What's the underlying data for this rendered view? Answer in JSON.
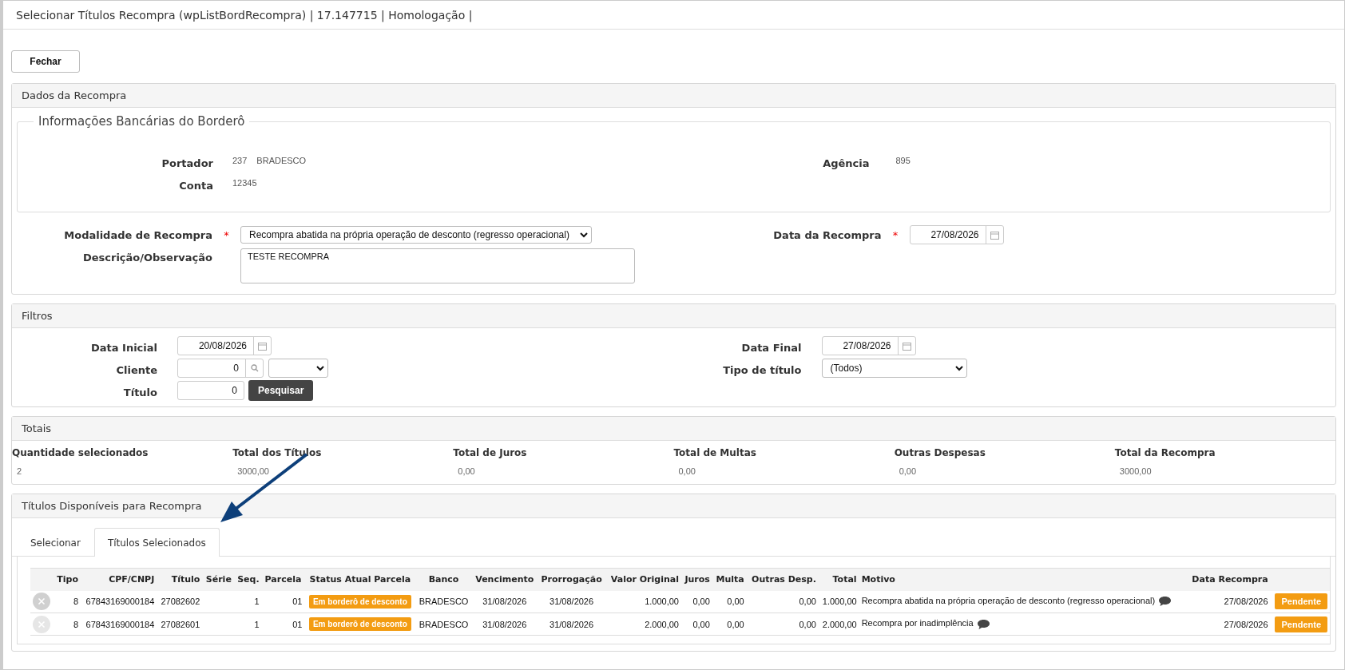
{
  "window": {
    "title": "Selecionar Títulos Recompra (wpListBordRecompra) | 17.147715 | Homologação |"
  },
  "close_button": "Fechar",
  "dados": {
    "title": "Dados da Recompra",
    "bank_info": {
      "legend": "Informações Bancárias do Borderô",
      "portador_label": "Portador",
      "portador_code": "237",
      "portador_name": "BRADESCO",
      "agencia_label": "Agência",
      "agencia": "895",
      "conta_label": "Conta",
      "conta": "12345"
    },
    "modalidade": {
      "label": "Modalidade de Recompra",
      "required_mark": "*",
      "value": "Recompra abatida na própria operação de desconto (regresso operacional)"
    },
    "data_recompra": {
      "label": "Data da Recompra",
      "required_mark": "*",
      "value": "27/08/2026"
    },
    "descricao": {
      "label": "Descrição/Observação",
      "value": "TESTE RECOMPRA"
    }
  },
  "filtros": {
    "title": "Filtros",
    "data_inicial": {
      "label": "Data Inicial",
      "value": "20/08/2026"
    },
    "data_final": {
      "label": "Data Final",
      "value": "27/08/2026"
    },
    "cliente": {
      "label": "Cliente",
      "value": "0"
    },
    "tipo_titulo": {
      "label": "Tipo de título",
      "value": "(Todos)"
    },
    "titulo": {
      "label": "Título",
      "value": "0"
    },
    "search_button": "Pesquisar"
  },
  "totais": {
    "title": "Totais",
    "items": [
      {
        "label": "Quantidade selecionados",
        "value": "2"
      },
      {
        "label": "Total dos Títulos",
        "value": "3000,00"
      },
      {
        "label": "Total de Juros",
        "value": "0,00"
      },
      {
        "label": "Total de Multas",
        "value": "0,00"
      },
      {
        "label": "Outras Despesas",
        "value": "0,00"
      },
      {
        "label": "Total da Recompra",
        "value": "3000,00"
      }
    ]
  },
  "titulos": {
    "title": "Títulos Disponíveis para Recompra",
    "tabs": [
      {
        "label": "Selecionar",
        "selected": false
      },
      {
        "label": "Títulos Selecionados",
        "selected": true
      }
    ],
    "table": {
      "columns": [
        "Tipo",
        "CPF/CNPJ",
        "Título",
        "Série",
        "Seq.",
        "Parcela",
        "Status Atual Parcela",
        "Banco",
        "Vencimento",
        "Prorrogação",
        "Valor Original",
        "Juros",
        "Multa",
        "Outras Desp.",
        "Total",
        "Motivo",
        "Data Recompra"
      ],
      "rows": [
        {
          "tipo": "8",
          "cpf_cnpj": "67843169000184",
          "titulo": "27082602",
          "serie": "",
          "seq": "1",
          "parcela": "01",
          "status": "Em borderô de desconto",
          "banco": "BRADESCO",
          "vencimento": "31/08/2026",
          "prorrogacao": "31/08/2026",
          "valor_original": "1.000,00",
          "juros": "0,00",
          "multa": "0,00",
          "outras_desp": "0,00",
          "total": "1.000,00",
          "motivo": "Recompra abatida na própria operação de desconto (regresso operacional)",
          "data_recompra": "27/08/2026",
          "action": "Pendente",
          "hovered": true
        },
        {
          "tipo": "8",
          "cpf_cnpj": "67843169000184",
          "titulo": "27082601",
          "serie": "",
          "seq": "1",
          "parcela": "01",
          "status": "Em borderô de desconto",
          "banco": "BRADESCO",
          "vencimento": "31/08/2026",
          "prorrogacao": "31/08/2026",
          "valor_original": "2.000,00",
          "juros": "0,00",
          "multa": "0,00",
          "outras_desp": "0,00",
          "total": "2.000,00",
          "motivo": "Recompra por inadimplência",
          "data_recompra": "27/08/2026",
          "action": "Pendente",
          "hovered": false
        }
      ]
    }
  }
}
